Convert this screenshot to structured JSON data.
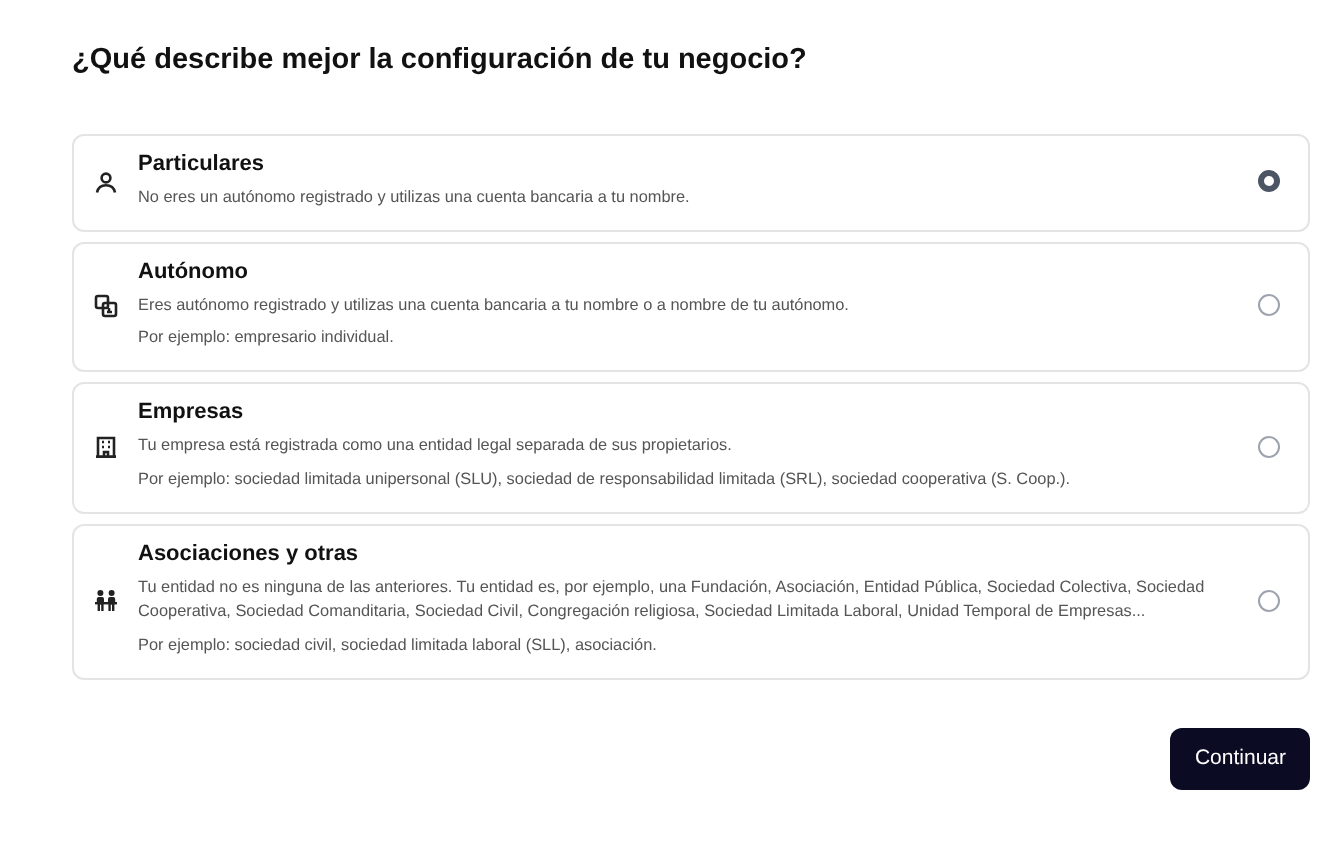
{
  "heading": "¿Qué describe mejor la configuración de tu negocio?",
  "options": [
    {
      "title": "Particulares",
      "description": "No eres un autónomo registrado y utilizas una cuenta bancaria a tu nombre.",
      "selected": true
    },
    {
      "title": "Autónomo",
      "description": "Eres autónomo registrado y utilizas una cuenta bancaria a tu nombre o a nombre de tu autónomo.",
      "example": "Por ejemplo: empresario individual.",
      "selected": false
    },
    {
      "title": "Empresas",
      "description": "Tu empresa está registrada como una entidad legal separada de sus propietarios.",
      "example": "Por ejemplo: sociedad limitada unipersonal (SLU), sociedad de responsabilidad limitada (SRL), sociedad cooperativa (S. Coop.).",
      "selected": false
    },
    {
      "title": "Asociaciones y otras",
      "description": "Tu entidad no es ninguna de las anteriores. Tu entidad es, por ejemplo, una Fundación, Asociación, Entidad Pública, Sociedad Colectiva, Sociedad Cooperativa, Sociedad Comanditaria, Sociedad Civil, Congregación religiosa, Sociedad Limitada Laboral, Unidad Temporal de Empresas...",
      "example": "Por ejemplo: sociedad civil, sociedad limitada laboral (SLL), asociación.",
      "selected": false
    }
  ],
  "button": "Continuar"
}
